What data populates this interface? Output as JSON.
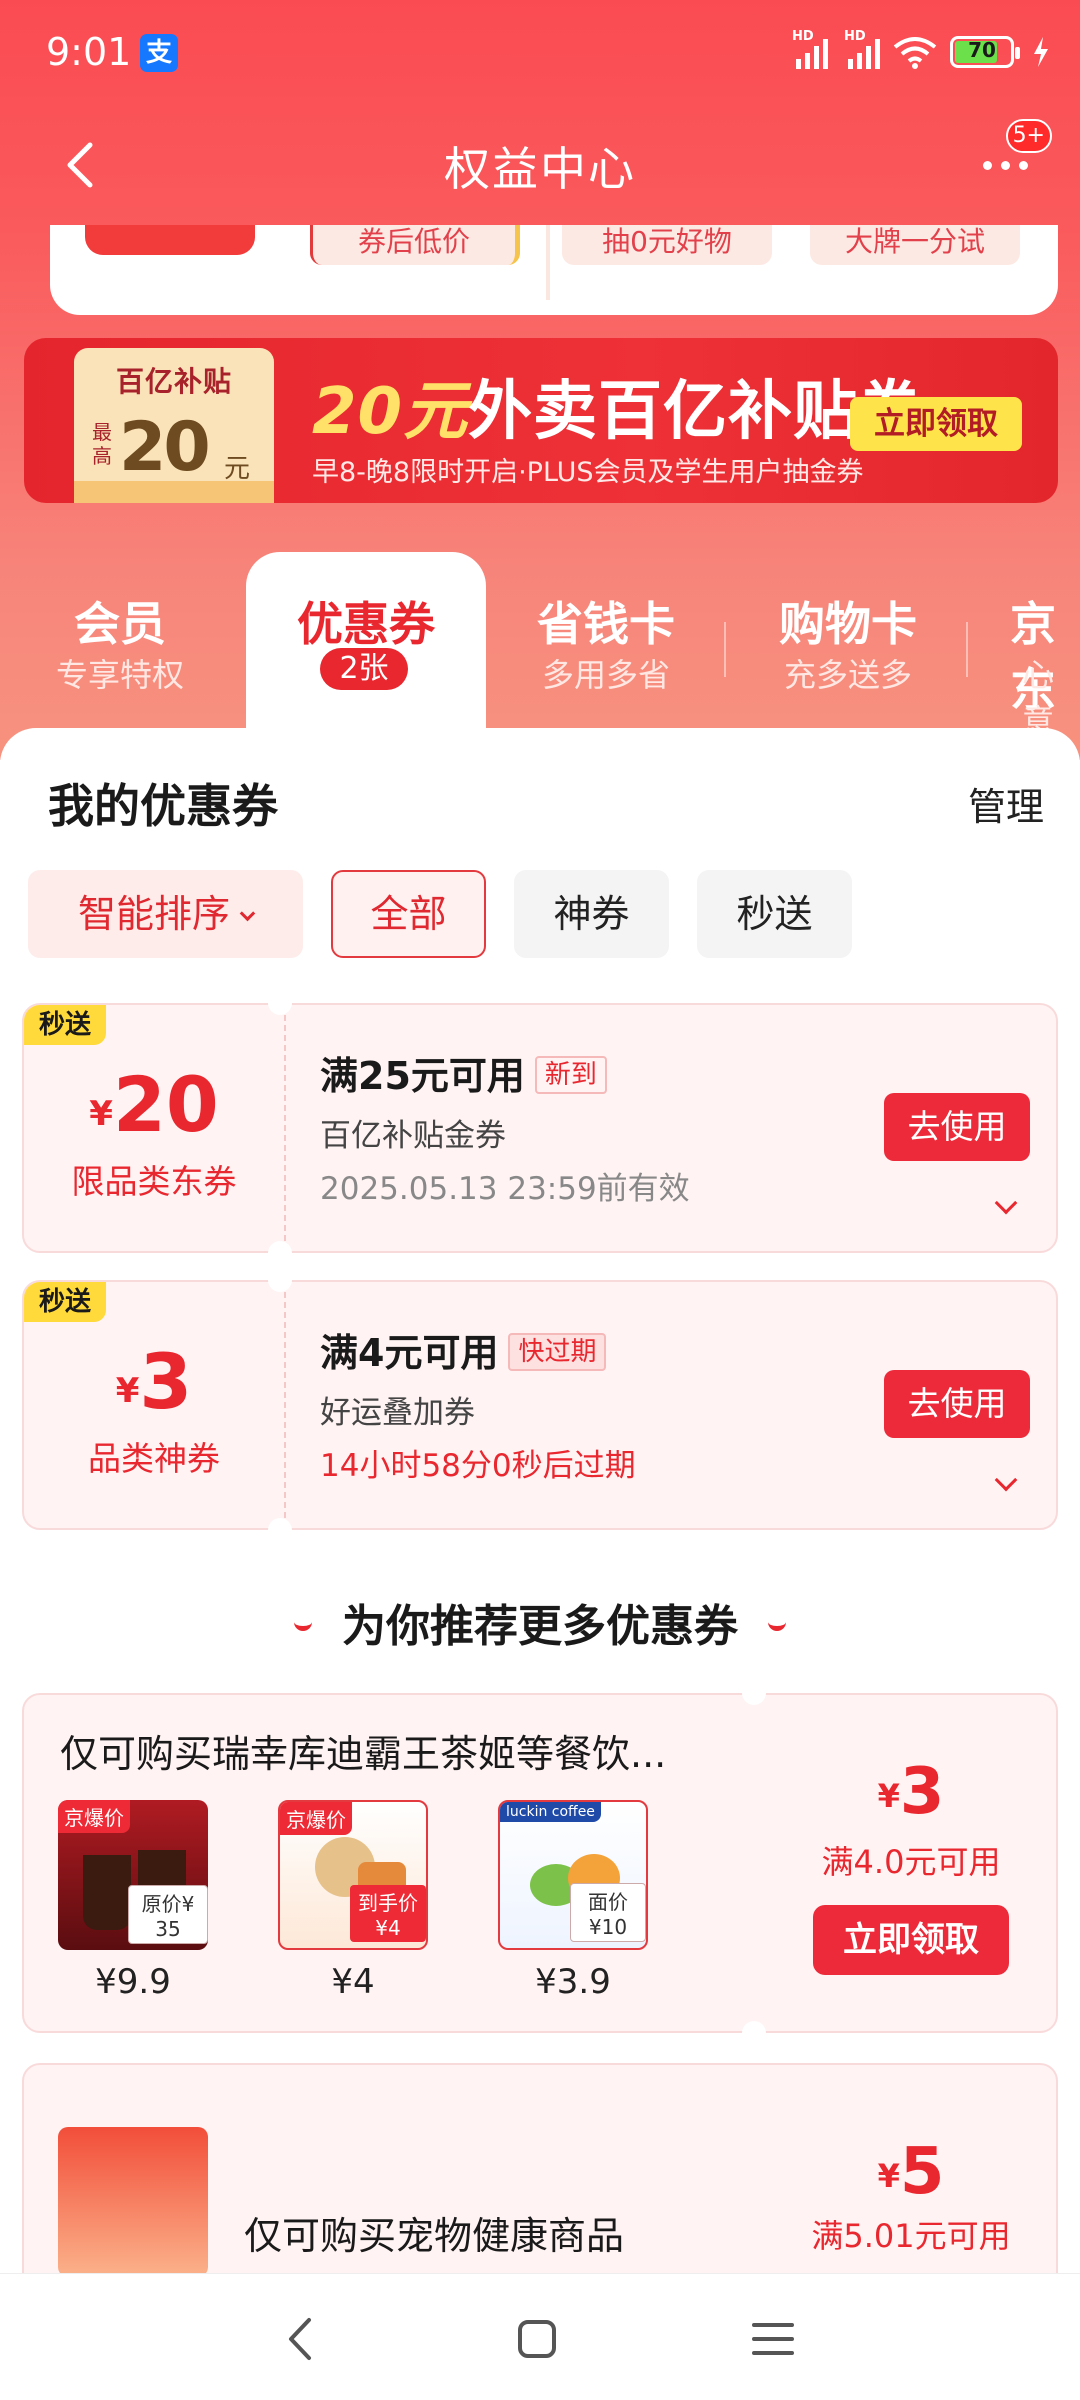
{
  "status": {
    "time": "9:01",
    "app_icon_char": "支",
    "battery": "70",
    "signal1": "HD",
    "signal2": "HD"
  },
  "nav": {
    "title": "权益中心",
    "badge": "5+"
  },
  "top_card": {
    "pills": [
      "券后低价",
      "抽0元好物",
      "大牌一分试"
    ]
  },
  "banner": {
    "ticket_title": "百亿补贴",
    "ticket_label": "最高",
    "ticket_amount": "20",
    "ticket_unit": "元",
    "title_highlight": "20元",
    "title_rest": "外卖百亿补贴券",
    "subtitle": "早8-晚8限时开启·PLUS会员及学生用户抽金券",
    "button": "立即领取"
  },
  "tabs": [
    {
      "title": "会员",
      "sub": "专享特权"
    },
    {
      "title": "优惠券",
      "badge": "2张"
    },
    {
      "title": "省钱卡",
      "sub": "多用多省"
    },
    {
      "title": "购物卡",
      "sub": "充多送多"
    },
    {
      "title": "京东",
      "sub": "心意"
    }
  ],
  "section": {
    "title": "我的优惠券",
    "manage": "管理"
  },
  "filters": {
    "sort": "智能排序",
    "all": "全部",
    "god": "神券",
    "instant": "秒送"
  },
  "coupons": [
    {
      "tag": "秒送",
      "currency": "¥",
      "amount": "20",
      "category": "限品类东券",
      "condition": "满25元可用",
      "flag": "新到",
      "name": "百亿补贴金券",
      "expiry": "2025.05.13 23:59前有效",
      "button": "去使用"
    },
    {
      "tag": "秒送",
      "currency": "¥",
      "amount": "3",
      "category": "品类神券",
      "condition": "满4元可用",
      "flag": "快过期",
      "name": "好运叠加券",
      "expiry": "14小时58分0秒后过期",
      "button": "去使用"
    }
  ],
  "recommend": {
    "title": "为你推荐更多优惠券",
    "cards": [
      {
        "desc": "仅可购买瑞幸库迪霸王茶姬等餐饮...",
        "products": [
          {
            "label": "京爆价",
            "tag": "原价¥ 35",
            "price": "¥9.9"
          },
          {
            "label": "京爆价",
            "tag": "到手价¥4",
            "price": "¥4"
          },
          {
            "label": "luckin coffee",
            "tag": "面价¥10",
            "price": "¥3.9"
          }
        ],
        "currency": "¥",
        "amount": "3",
        "condition": "满4.0元可用",
        "button": "立即领取"
      },
      {
        "desc": "仅可购买宠物健康商品",
        "currency": "¥",
        "amount": "5",
        "condition": "满5.01元可用"
      }
    ]
  },
  "colors": {
    "brand_red": "#e8272f",
    "header_red": "#fa4b52",
    "banner_yellow": "#ffe34a"
  },
  "icons": [
    "back-icon",
    "more-icon",
    "chevron-down-icon",
    "expand-icon",
    "nav-back-icon",
    "nav-home-icon",
    "nav-menu-icon"
  ]
}
